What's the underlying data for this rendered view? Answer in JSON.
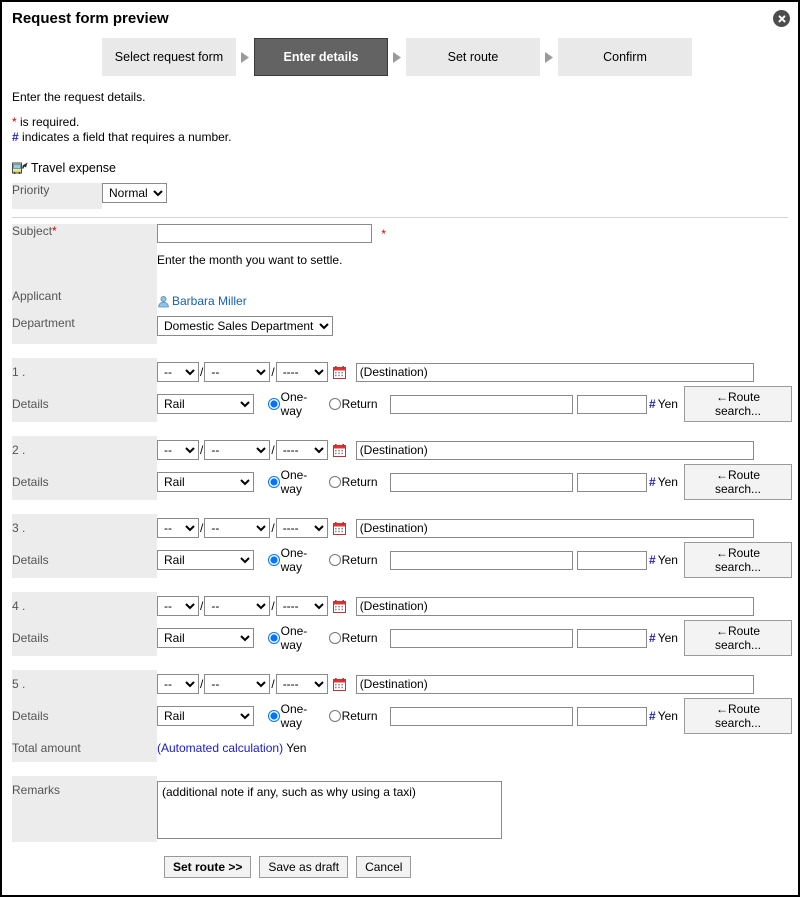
{
  "dialog": {
    "title": "Request form preview",
    "close_icon": "close-circle-icon"
  },
  "steps": [
    {
      "label": "Select request form",
      "active": false
    },
    {
      "label": "Enter details",
      "active": true
    },
    {
      "label": "Set route",
      "active": false
    },
    {
      "label": "Confirm",
      "active": false
    }
  ],
  "intro": {
    "instruction": "Enter the request details.",
    "required_note": " is required.",
    "required_symbol": "*",
    "number_note": " indicates a field that requires a number.",
    "number_symbol": "#"
  },
  "section": {
    "icon": "travel-expense-icon",
    "title": "Travel expense"
  },
  "priority": {
    "label": "Priority",
    "value": "Normal",
    "options": [
      "Normal"
    ]
  },
  "subject": {
    "label": "Subject",
    "required_marker": "*",
    "value": "",
    "hint": "Enter the month you want to settle."
  },
  "applicant": {
    "label": "Applicant",
    "name": "Barbara Miller",
    "icon": "person-icon"
  },
  "department": {
    "label": "Department",
    "value": "Domestic Sales Department",
    "options": [
      "Domestic Sales Department"
    ]
  },
  "expense_rows": [
    {
      "number": "1 .",
      "details_label": "Details",
      "month": "--",
      "day": "--",
      "year": "----",
      "calendar_icon": "calendar-icon",
      "destination_placeholder": "(Destination)",
      "destination_value": "",
      "transport": "Rail",
      "transport_options": [
        "Rail"
      ],
      "trip_type": "One-way",
      "one_way_label": "One-way",
      "return_label": "Return",
      "amount_text": "",
      "amount_number": "",
      "number_symbol": "#",
      "currency": "Yen",
      "route_button": "←Route search..."
    },
    {
      "number": "2 .",
      "details_label": "Details",
      "month": "--",
      "day": "--",
      "year": "----",
      "calendar_icon": "calendar-icon",
      "destination_placeholder": "(Destination)",
      "destination_value": "",
      "transport": "Rail",
      "transport_options": [
        "Rail"
      ],
      "trip_type": "One-way",
      "one_way_label": "One-way",
      "return_label": "Return",
      "amount_text": "",
      "amount_number": "",
      "number_symbol": "#",
      "currency": "Yen",
      "route_button": "←Route search..."
    },
    {
      "number": "3 .",
      "details_label": "Details",
      "month": "--",
      "day": "--",
      "year": "----",
      "calendar_icon": "calendar-icon",
      "destination_placeholder": "(Destination)",
      "destination_value": "",
      "transport": "Rail",
      "transport_options": [
        "Rail"
      ],
      "trip_type": "One-way",
      "one_way_label": "One-way",
      "return_label": "Return",
      "amount_text": "",
      "amount_number": "",
      "number_symbol": "#",
      "currency": "Yen",
      "route_button": "←Route search..."
    },
    {
      "number": "4 .",
      "details_label": "Details",
      "month": "--",
      "day": "--",
      "year": "----",
      "calendar_icon": "calendar-icon",
      "destination_placeholder": "(Destination)",
      "destination_value": "",
      "transport": "Rail",
      "transport_options": [
        "Rail"
      ],
      "trip_type": "One-way",
      "one_way_label": "One-way",
      "return_label": "Return",
      "amount_text": "",
      "amount_number": "",
      "number_symbol": "#",
      "currency": "Yen",
      "route_button": "←Route search..."
    },
    {
      "number": "5 .",
      "details_label": "Details",
      "month": "--",
      "day": "--",
      "year": "----",
      "calendar_icon": "calendar-icon",
      "destination_placeholder": "(Destination)",
      "destination_value": "",
      "transport": "Rail",
      "transport_options": [
        "Rail"
      ],
      "trip_type": "One-way",
      "one_way_label": "One-way",
      "return_label": "Return",
      "amount_text": "",
      "amount_number": "",
      "number_symbol": "#",
      "currency": "Yen",
      "route_button": "←Route search..."
    }
  ],
  "total": {
    "label": "Total amount",
    "value": "(Automated calculation)",
    "currency": "Yen"
  },
  "remarks": {
    "label": "Remarks",
    "placeholder": "(additional note if any, such as why using a taxi)",
    "value": ""
  },
  "footer": {
    "set_route": "Set route >>",
    "save_draft": "Save as draft",
    "cancel": "Cancel"
  },
  "colors": {
    "active_step_bg": "#636363",
    "step_bg": "#e9e9e9",
    "label_bg": "#ececec",
    "required_red": "#cc0000",
    "number_blue": "#2222cc",
    "link_blue": "#1a5fb4",
    "calc_blue": "#1a1acc"
  }
}
